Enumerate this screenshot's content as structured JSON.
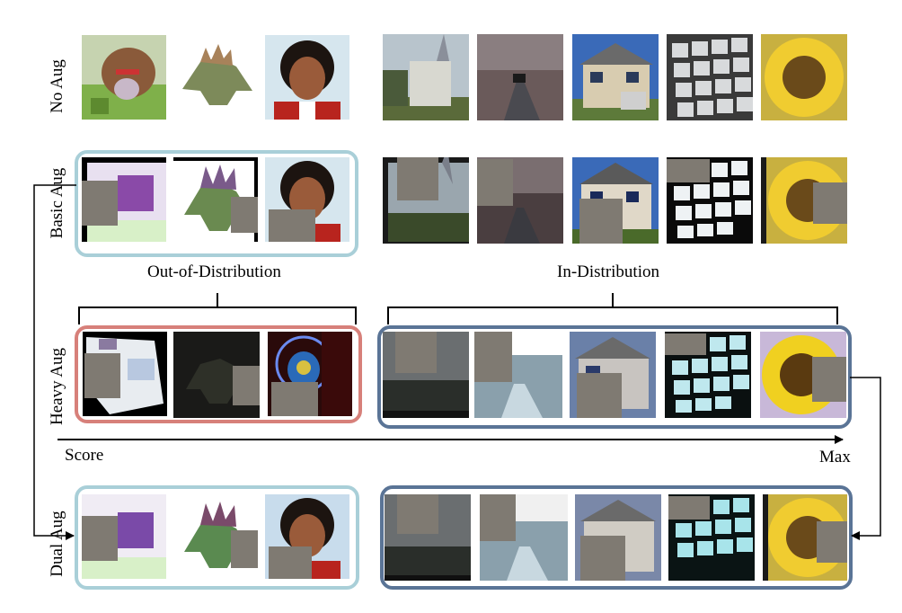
{
  "rows": {
    "no_aug": "No Aug",
    "basic_aug": "Basic Aug",
    "heavy_aug": "Heavy Aug",
    "dual_aug": "Dual Aug"
  },
  "captions": {
    "ood": "Out-of-Distribution",
    "id": "In-Distribution"
  },
  "axis": {
    "start": "Score",
    "end": "Max"
  },
  "colors": {
    "light_frame": "#a9cfd8",
    "red_frame": "#d7807a",
    "blue_frame": "#5a7496",
    "cutout_patch": "#7f7a72"
  }
}
